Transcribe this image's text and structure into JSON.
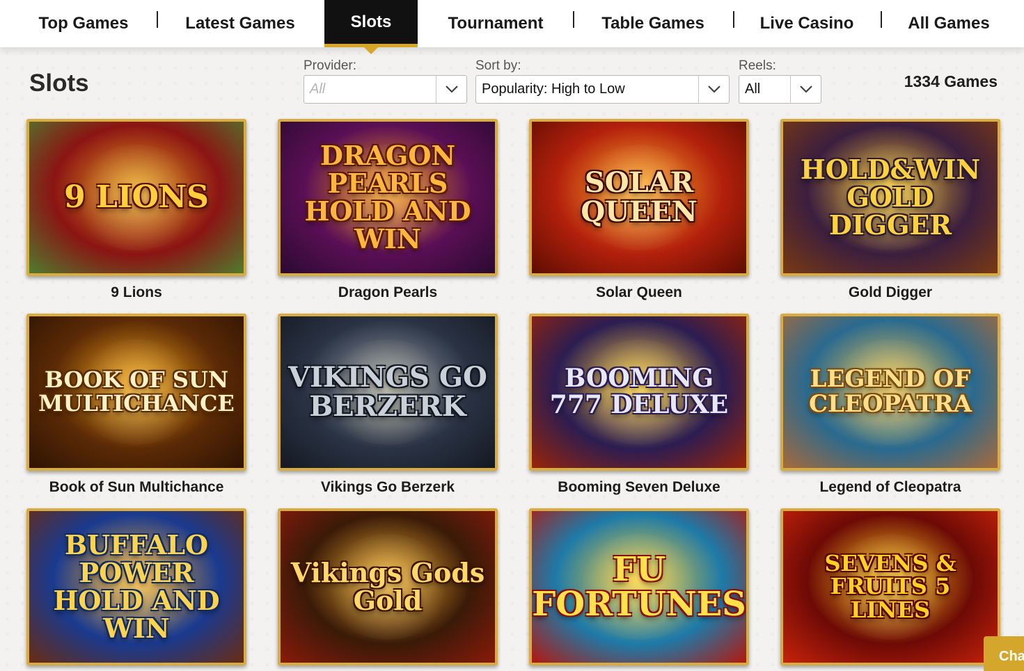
{
  "nav": {
    "items": [
      {
        "label": "Top Games"
      },
      {
        "label": "Latest Games"
      },
      {
        "label": "Slots",
        "active": true
      },
      {
        "label": "Tournament"
      },
      {
        "label": "Table Games"
      },
      {
        "label": "Live Casino"
      },
      {
        "label": "All Games"
      }
    ]
  },
  "page": {
    "title": "Slots",
    "count": "1334 Games"
  },
  "filters": {
    "provider": {
      "label": "Provider:",
      "placeholder": "All",
      "value": ""
    },
    "sort": {
      "label": "Sort by:",
      "value": "Popularity: High to Low"
    },
    "reels": {
      "label": "Reels:",
      "value": "All"
    }
  },
  "games": [
    {
      "name": "9 Lions",
      "logo": "9 LIONS",
      "colors": [
        "#8b1414",
        "#e6a21d",
        "#4e7d2e"
      ]
    },
    {
      "name": "Dragon Pearls",
      "logo": "DRAGON PEARLS HOLD AND WIN",
      "colors": [
        "#5a0f55",
        "#ff9a1a",
        "#2a0a30"
      ]
    },
    {
      "name": "Solar Queen",
      "logo": "SOLAR QUEEN",
      "colors": [
        "#b3200c",
        "#ffb02e",
        "#5e0d02"
      ]
    },
    {
      "name": "Gold Digger",
      "logo": "HOLD&WIN GOLD DIGGER",
      "colors": [
        "#3b1e3f",
        "#f2c12e",
        "#7a3a12"
      ]
    },
    {
      "name": "Book of Sun Multichance",
      "logo": "BOOK OF SUN MULTICHANCE",
      "colors": [
        "#5c2a06",
        "#f5a719",
        "#2d1403"
      ]
    },
    {
      "name": "Vikings Go Berzerk",
      "logo": "VIKINGS GO BERZERK",
      "colors": [
        "#2a3344",
        "#9ba3ad",
        "#141922"
      ]
    },
    {
      "name": "Booming Seven Deluxe",
      "logo": "BOOMING 777 DELUXE",
      "colors": [
        "#2c1d52",
        "#ffd23c",
        "#9a2408"
      ]
    },
    {
      "name": "Legend of Cleopatra",
      "logo": "LEGEND OF CLEOPATRA",
      "colors": [
        "#2a6a8f",
        "#f0c24a",
        "#a86a3a"
      ]
    },
    {
      "name": "",
      "logo": "BUFFALO POWER HOLD AND WIN",
      "colors": [
        "#1a3a8f",
        "#ffb52b",
        "#6a2b10"
      ]
    },
    {
      "name": "",
      "logo": "Vikings Gods Gold",
      "colors": [
        "#3a1a08",
        "#f2b033",
        "#8a1a0a"
      ]
    },
    {
      "name": "",
      "logo": "FU FORTUNES",
      "colors": [
        "#1d7aa8",
        "#ffcf2e",
        "#b3180e"
      ]
    },
    {
      "name": "",
      "logo": "SEVENS & FRUITS 5 LINES",
      "colors": [
        "#6d0a06",
        "#ffcc1f",
        "#c8230a"
      ]
    }
  ],
  "chat": {
    "label": "Cha"
  },
  "icons": {
    "dropdown": "chevron-down-icon"
  }
}
